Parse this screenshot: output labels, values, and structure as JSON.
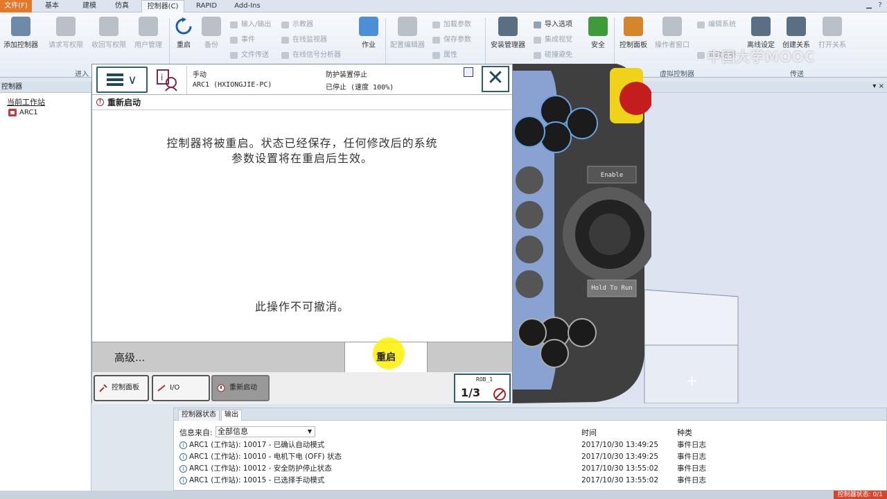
{
  "ribbon_tabs": [
    "文件(F)",
    "基本",
    "建模",
    "仿真",
    "控制器(C)",
    "RAPID",
    "Add-Ins"
  ],
  "ribbon": {
    "add_controller": "添加控制器",
    "request_write": "请求写权限",
    "release_write": "收回写权限",
    "user_manage": "用户管理",
    "restart": "重启",
    "backup": "备份",
    "io": "输入/输出",
    "events": "事件",
    "file_transfer": "文件传送",
    "teach": "示教器",
    "online_monitor": "在线监视器",
    "online_signal": "在线信号分析器",
    "job": "作业",
    "config_editor": "配置编辑器",
    "load_param": "加载参数",
    "save_param": "保存参数",
    "properties": "属性",
    "safety_manager": "安装管理器",
    "import_options": "导入选项",
    "integrated_vision": "集成视觉",
    "conflict": "碰撞避免",
    "safety": "安全",
    "control_panel": "控制面板",
    "operator_window": "操作者窗口",
    "edit_system": "编辑系统",
    "modify_options": "修改选项",
    "offline_set": "离线设定",
    "create_relation": "创建关系",
    "open_relation": "打开关系",
    "group_enter": "进入",
    "group_virtual": "虚拟控制器",
    "group_transfer": "传送"
  },
  "left_panel": {
    "header": "控制器",
    "root": "当前工作站",
    "item": "ARC1"
  },
  "flexpendant": {
    "mode": "手动",
    "system": "ARC1 (HXIONGJIE-PC)",
    "state": "防护装置停止",
    "speed": "已停止 (速度 100%)",
    "title": "重新启动",
    "message_line1": "控制器将被重启。状态已经保存，任何修改后的系统",
    "message_line2": "参数设置将在重启后生效。",
    "undo_note": "此操作不可撤消。",
    "advanced": "高级...",
    "restart_button": "重启",
    "task_control_panel": "控制面板",
    "task_io": "I/O",
    "task_restart": "重新启动",
    "quickset_robot": "ROB_1",
    "quickset_fraction": "1/3"
  },
  "pendant_hw": {
    "enable": "Enable",
    "hold": "Hold To Run"
  },
  "output": {
    "tabs": [
      "控制器状态",
      "输出"
    ],
    "filter_label": "信息来自:",
    "filter_value": "全部信息",
    "col_time": "时间",
    "col_type": "种类",
    "rows": [
      {
        "msg": "ARC1 (工作站): 10017 - 已确认自动模式",
        "time": "2017/10/30 13:49:25",
        "type": "事件日志"
      },
      {
        "msg": "ARC1 (工作站): 10010 - 电机下电 (OFF) 状态",
        "time": "2017/10/30 13:49:25",
        "type": "事件日志"
      },
      {
        "msg": "ARC1 (工作站): 10012 - 安全防护停止状态",
        "time": "2017/10/30 13:55:02",
        "type": "事件日志"
      },
      {
        "msg": "ARC1 (工作站): 10015 - 已选择手动模式",
        "time": "2017/10/30 13:55:02",
        "type": "事件日志"
      }
    ]
  },
  "statusbar": {
    "controller_status": "控制器状态: 0/1"
  },
  "watermark": "中国大学MOOC"
}
